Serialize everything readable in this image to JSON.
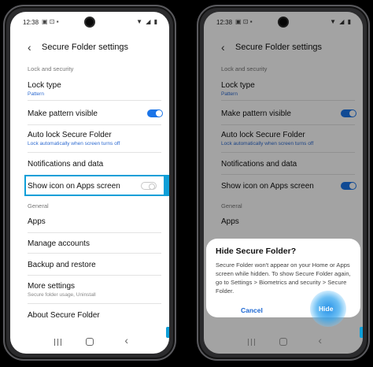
{
  "status": {
    "time": "12:38",
    "notif_icons": "▣ ⊡ ▪",
    "right_icons": "▼ ◢ ▮"
  },
  "header": {
    "back_icon": "back-arrow-icon",
    "title": "Secure Folder settings"
  },
  "sections": {
    "lock_and_security": "Lock and security",
    "general": "General"
  },
  "settings": {
    "lock_type": {
      "title": "Lock type",
      "sub": "Pattern"
    },
    "pattern_visible": {
      "title": "Make pattern visible",
      "toggle": "on"
    },
    "auto_lock": {
      "title": "Auto lock Secure Folder",
      "sub": "Lock automatically when screen turns off"
    },
    "notifications": {
      "title": "Notifications and data"
    },
    "show_icon": {
      "title": "Show icon on Apps screen",
      "toggle_left": "off",
      "toggle_right": "on"
    },
    "apps": {
      "title": "Apps"
    },
    "manage_accounts": {
      "title": "Manage accounts"
    },
    "backup": {
      "title": "Backup and restore"
    },
    "more_settings": {
      "title": "More settings",
      "sub": "Secure folder usage, Uninstall"
    },
    "about": {
      "title": "About Secure Folder"
    }
  },
  "dialog": {
    "title": "Hide Secure Folder?",
    "message": "Secure Folder won't appear on your Home or Apps screen while hidden. To show Secure Folder again, go to Settings > Biometrics and security > Secure Folder.",
    "cancel": "Cancel",
    "hide": "Hide"
  },
  "colors": {
    "accent": "#1a74e8",
    "highlight": "#0e9fd8",
    "link": "#2e6bd1"
  }
}
